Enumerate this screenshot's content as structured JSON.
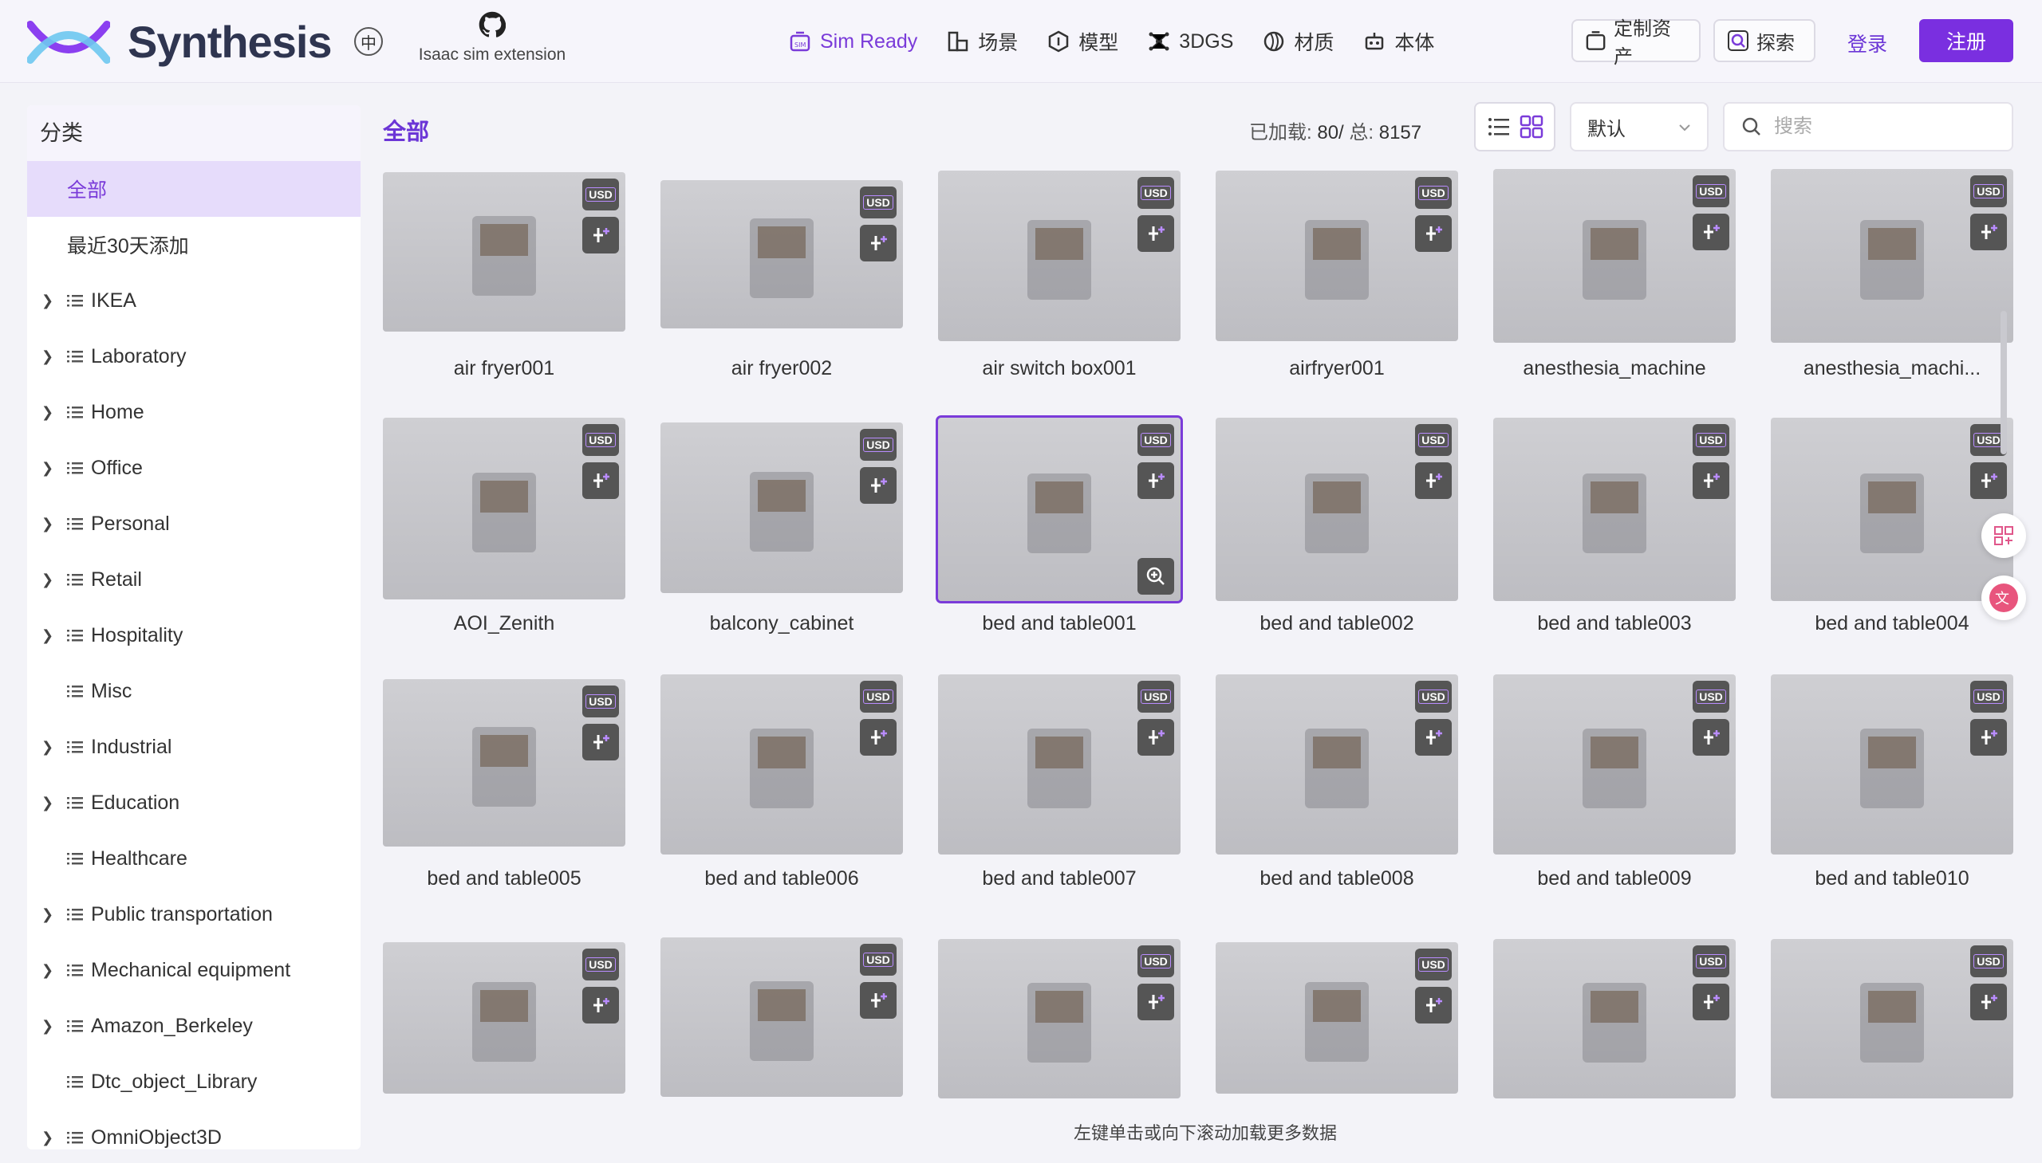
{
  "header": {
    "brand": "Synthesis",
    "lang": "中",
    "extension_label": "Isaac sim extension",
    "nav": [
      {
        "label": "Sim Ready",
        "icon": "sim-icon"
      },
      {
        "label": "场景",
        "icon": "scene-icon"
      },
      {
        "label": "模型",
        "icon": "model-icon"
      },
      {
        "label": "3DGS",
        "icon": "3dgs-icon"
      },
      {
        "label": "材质",
        "icon": "material-icon"
      },
      {
        "label": "本体",
        "icon": "robot-icon"
      }
    ],
    "custom_assets": "定制资产",
    "explore": "探索",
    "login": "登录",
    "register": "注册"
  },
  "sidebar": {
    "title": "分类",
    "items": [
      {
        "label": "全部"
      },
      {
        "label": "最近30天添加"
      },
      {
        "label": "IKEA"
      },
      {
        "label": "Laboratory"
      },
      {
        "label": "Home"
      },
      {
        "label": "Office"
      },
      {
        "label": "Personal"
      },
      {
        "label": "Retail"
      },
      {
        "label": "Hospitality"
      },
      {
        "label": "Misc"
      },
      {
        "label": "Industrial"
      },
      {
        "label": "Education"
      },
      {
        "label": "Healthcare"
      },
      {
        "label": "Public transportation"
      },
      {
        "label": "Mechanical equipment"
      },
      {
        "label": "Amazon_Berkeley"
      },
      {
        "label": "Dtc_object_Library"
      },
      {
        "label": "OmniObject3D"
      }
    ]
  },
  "main": {
    "title": "全部",
    "loaded_label": "已加载:",
    "loaded": "80/",
    "total_label": "总:",
    "total": "8157",
    "sort": "默认",
    "search_placeholder": "搜索",
    "usd_badge": "USD",
    "load_more": "左键单击或向下滚动加载更多数据",
    "cards": [
      {
        "name": "air fryer001"
      },
      {
        "name": "air fryer002"
      },
      {
        "name": "air switch box001"
      },
      {
        "name": "airfryer001"
      },
      {
        "name": "anesthesia_machine"
      },
      {
        "name": "anesthesia_machi..."
      },
      {
        "name": "AOI_Zenith"
      },
      {
        "name": "balcony_cabinet"
      },
      {
        "name": "bed and table001"
      },
      {
        "name": "bed and table002"
      },
      {
        "name": "bed and table003"
      },
      {
        "name": "bed and table004"
      },
      {
        "name": "bed and table005"
      },
      {
        "name": "bed and table006"
      },
      {
        "name": "bed and table007"
      },
      {
        "name": "bed and table008"
      },
      {
        "name": "bed and table009"
      },
      {
        "name": "bed and table010"
      },
      {
        "name": ""
      },
      {
        "name": ""
      },
      {
        "name": ""
      },
      {
        "name": ""
      },
      {
        "name": ""
      },
      {
        "name": ""
      }
    ]
  }
}
